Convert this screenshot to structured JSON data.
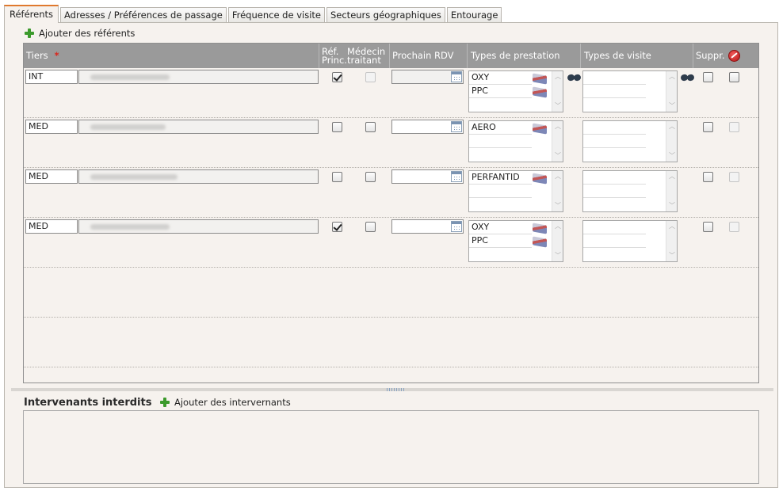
{
  "tabs": [
    {
      "label": "Référents",
      "active": true
    },
    {
      "label": "Adresses / Préférences de passage",
      "active": false
    },
    {
      "label": "Fréquence de visite",
      "active": false
    },
    {
      "label": "Secteurs géographiques",
      "active": false
    },
    {
      "label": "Entourage",
      "active": false
    }
  ],
  "referents": {
    "add_label": "Ajouter des référents",
    "headers": {
      "tiers": "Tiers",
      "required_mark": "*",
      "ref_princ": "Réf. Princ.",
      "medecin_traitant": "Médecin traitant",
      "prochain_rdv": "Prochain RDV",
      "types_prestation": "Types de prestation",
      "types_visite": "Types de visite",
      "suppr": "Suppr."
    },
    "rows": [
      {
        "code": "INT",
        "ref_princ": true,
        "medecin": false,
        "medecin_disabled": true,
        "date": "",
        "prestations": [
          "OXY",
          "PPC",
          ""
        ],
        "visites": [
          "",
          "",
          ""
        ],
        "suppr": false,
        "extra": false,
        "extra_disabled": false
      },
      {
        "code": "MED",
        "ref_princ": false,
        "medecin": false,
        "medecin_disabled": false,
        "date": "",
        "prestations": [
          "AERO",
          "",
          ""
        ],
        "visites": [
          "",
          "",
          ""
        ],
        "suppr": false,
        "extra": false,
        "extra_disabled": true
      },
      {
        "code": "MED",
        "ref_princ": false,
        "medecin": false,
        "medecin_disabled": false,
        "date": "",
        "prestations": [
          "PERFANTID",
          "",
          ""
        ],
        "visites": [
          "",
          "",
          ""
        ],
        "suppr": false,
        "extra": false,
        "extra_disabled": true
      },
      {
        "code": "MED",
        "ref_princ": true,
        "medecin": false,
        "medecin_disabled": false,
        "date": "",
        "prestations": [
          "OXY",
          "PPC",
          ""
        ],
        "visites": [
          "",
          "",
          ""
        ],
        "suppr": false,
        "extra": false,
        "extra_disabled": true
      }
    ]
  },
  "intervenants": {
    "title": "Intervenants interdits",
    "add_label": "Ajouter des intervernants"
  }
}
